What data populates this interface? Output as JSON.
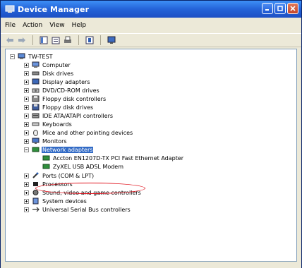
{
  "window": {
    "title": "Device Manager"
  },
  "menu": [
    "File",
    "Action",
    "View",
    "Help"
  ],
  "toolbar": {
    "icons": [
      "back-icon",
      "forward-icon",
      "show-hide-tree-icon",
      "properties-icon",
      "print-icon",
      "help-icon",
      "scan-hardware-icon"
    ]
  },
  "tree": {
    "root": "TW-TEST",
    "items": [
      "Computer",
      "Disk drives",
      "Display adapters",
      "DVD/CD-ROM drives",
      "Floppy disk controllers",
      "Floppy disk drives",
      "IDE ATA/ATAPI controllers",
      "Keyboards",
      "Mice and other pointing devices",
      "Monitors",
      "Network adapters",
      "Ports (COM & LPT)",
      "Processors",
      "Sound, video and game controllers",
      "System devices",
      "Universal Serial Bus controllers"
    ],
    "network_children": [
      "Accton EN1207D-TX PCI Fast Ethernet Adapter",
      "ZyXEL USB ADSL Modem"
    ]
  },
  "colors": {
    "titlebar": "#2463d8",
    "selection": "#316ac5",
    "highlight_circle": "#e0141e"
  }
}
